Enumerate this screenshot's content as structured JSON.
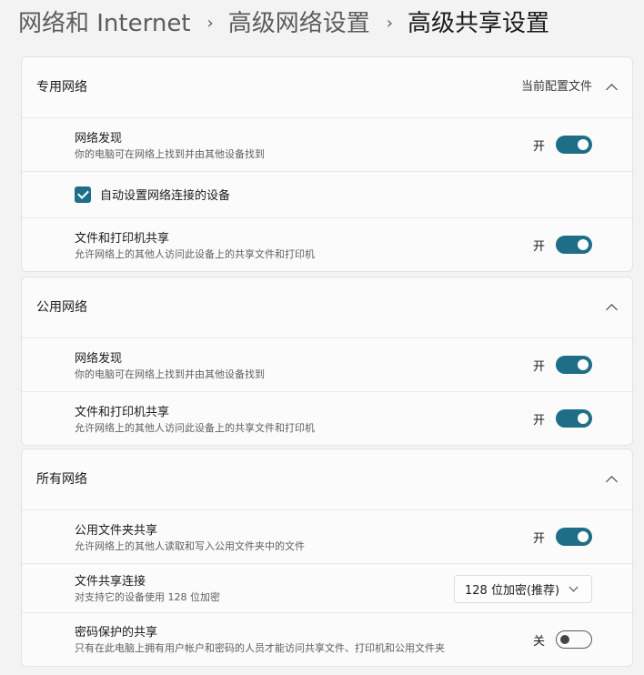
{
  "breadcrumb": {
    "items": [
      "网络和 Internet",
      "高级网络设置"
    ],
    "current": "高级共享设置",
    "separator": "›"
  },
  "private_network": {
    "title": "专用网络",
    "hint": "当前配置文件",
    "discovery": {
      "title": "网络发现",
      "desc": "你的电脑可在网络上找到并由其他设备找到",
      "state": "开",
      "on": true
    },
    "auto_setup": {
      "label": "自动设置网络连接的设备",
      "checked": true
    },
    "file_printer": {
      "title": "文件和打印机共享",
      "desc": "允许网络上的其他人访问此设备上的共享文件和打印机",
      "state": "开",
      "on": true
    }
  },
  "public_network": {
    "title": "公用网络",
    "discovery": {
      "title": "网络发现",
      "desc": "你的电脑可在网络上找到并由其他设备找到",
      "state": "开",
      "on": true
    },
    "file_printer": {
      "title": "文件和打印机共享",
      "desc": "允许网络上的其他人访问此设备上的共享文件和打印机",
      "state": "开",
      "on": true
    }
  },
  "all_networks": {
    "title": "所有网络",
    "public_folder": {
      "title": "公用文件夹共享",
      "desc": "允许网络上的其他人读取和写入公用文件夹中的文件",
      "state": "开",
      "on": true
    },
    "connection": {
      "title": "文件共享连接",
      "desc": "对支持它的设备使用 128 位加密",
      "value": "128 位加密(推荐)"
    },
    "password": {
      "title": "密码保护的共享",
      "desc": "只有在此电脑上拥有用户帐户和密码的人员才能访问共享文件、打印机和公用文件夹",
      "state": "关",
      "on": false
    }
  },
  "colors": {
    "accent": "#1f6e87",
    "background": "#f3f3f3",
    "card": "#fbfbfb"
  },
  "icons": {
    "section_expand": "chevron-up-icon",
    "dropdown": "chevron-down-icon",
    "check": "checkmark-icon"
  }
}
